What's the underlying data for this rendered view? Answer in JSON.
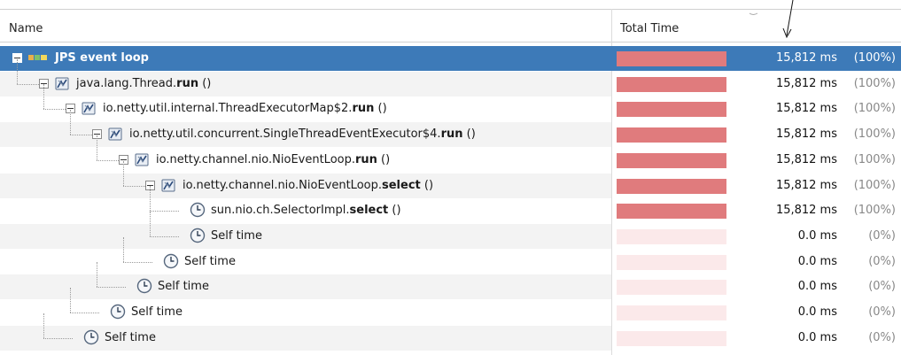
{
  "header": {
    "name_col": "Name",
    "time_col": "Total Time"
  },
  "rows": [
    {
      "label_plain": "",
      "label_bold": "JPS event loop",
      "time": "15,812 ms",
      "pct": "(100%)",
      "fill": 1.0
    },
    {
      "label_plain": "java.lang.Thread.",
      "label_bold": "run",
      "suffix": " ()",
      "time": "15,812 ms",
      "pct": "(100%)",
      "fill": 1.0
    },
    {
      "label_plain": "io.netty.util.internal.ThreadExecutorMap$2.",
      "label_bold": "run",
      "suffix": " ()",
      "time": "15,812 ms",
      "pct": "(100%)",
      "fill": 1.0
    },
    {
      "label_plain": "io.netty.util.concurrent.SingleThreadEventExecutor$4.",
      "label_bold": "run",
      "suffix": " ()",
      "time": "15,812 ms",
      "pct": "(100%)",
      "fill": 1.0
    },
    {
      "label_plain": "io.netty.channel.nio.NioEventLoop.",
      "label_bold": "run",
      "suffix": " ()",
      "time": "15,812 ms",
      "pct": "(100%)",
      "fill": 1.0
    },
    {
      "label_plain": "io.netty.channel.nio.NioEventLoop.",
      "label_bold": "select",
      "suffix": " ()",
      "time": "15,812 ms",
      "pct": "(100%)",
      "fill": 1.0
    },
    {
      "label_plain": "sun.nio.ch.SelectorImpl.",
      "label_bold": "select",
      "suffix": " ()",
      "time": "15,812 ms",
      "pct": "(100%)",
      "fill": 1.0
    },
    {
      "label_plain": "Self time",
      "label_bold": "",
      "suffix": "",
      "time": "0.0 ms",
      "pct": "(0%)",
      "fill": 0.0
    },
    {
      "label_plain": "Self time",
      "label_bold": "",
      "suffix": "",
      "time": "0.0 ms",
      "pct": "(0%)",
      "fill": 0.0
    },
    {
      "label_plain": "Self time",
      "label_bold": "",
      "suffix": "",
      "time": "0.0 ms",
      "pct": "(0%)",
      "fill": 0.0
    },
    {
      "label_plain": "Self time",
      "label_bold": "",
      "suffix": "",
      "time": "0.0 ms",
      "pct": "(0%)",
      "fill": 0.0
    },
    {
      "label_plain": "Self time",
      "label_bold": "",
      "suffix": "",
      "time": "0.0 ms",
      "pct": "(0%)",
      "fill": 0.0
    }
  ],
  "icons": {
    "thread": "thread-group-icon",
    "method": "method-call-icon",
    "clock": "self-time-clock-icon",
    "toggle": "collapse-toggle-icon"
  },
  "colors": {
    "selection": "#3d7ab8",
    "bar_fill": "#e07b7d",
    "bar_bg": "#fbe9ea"
  }
}
